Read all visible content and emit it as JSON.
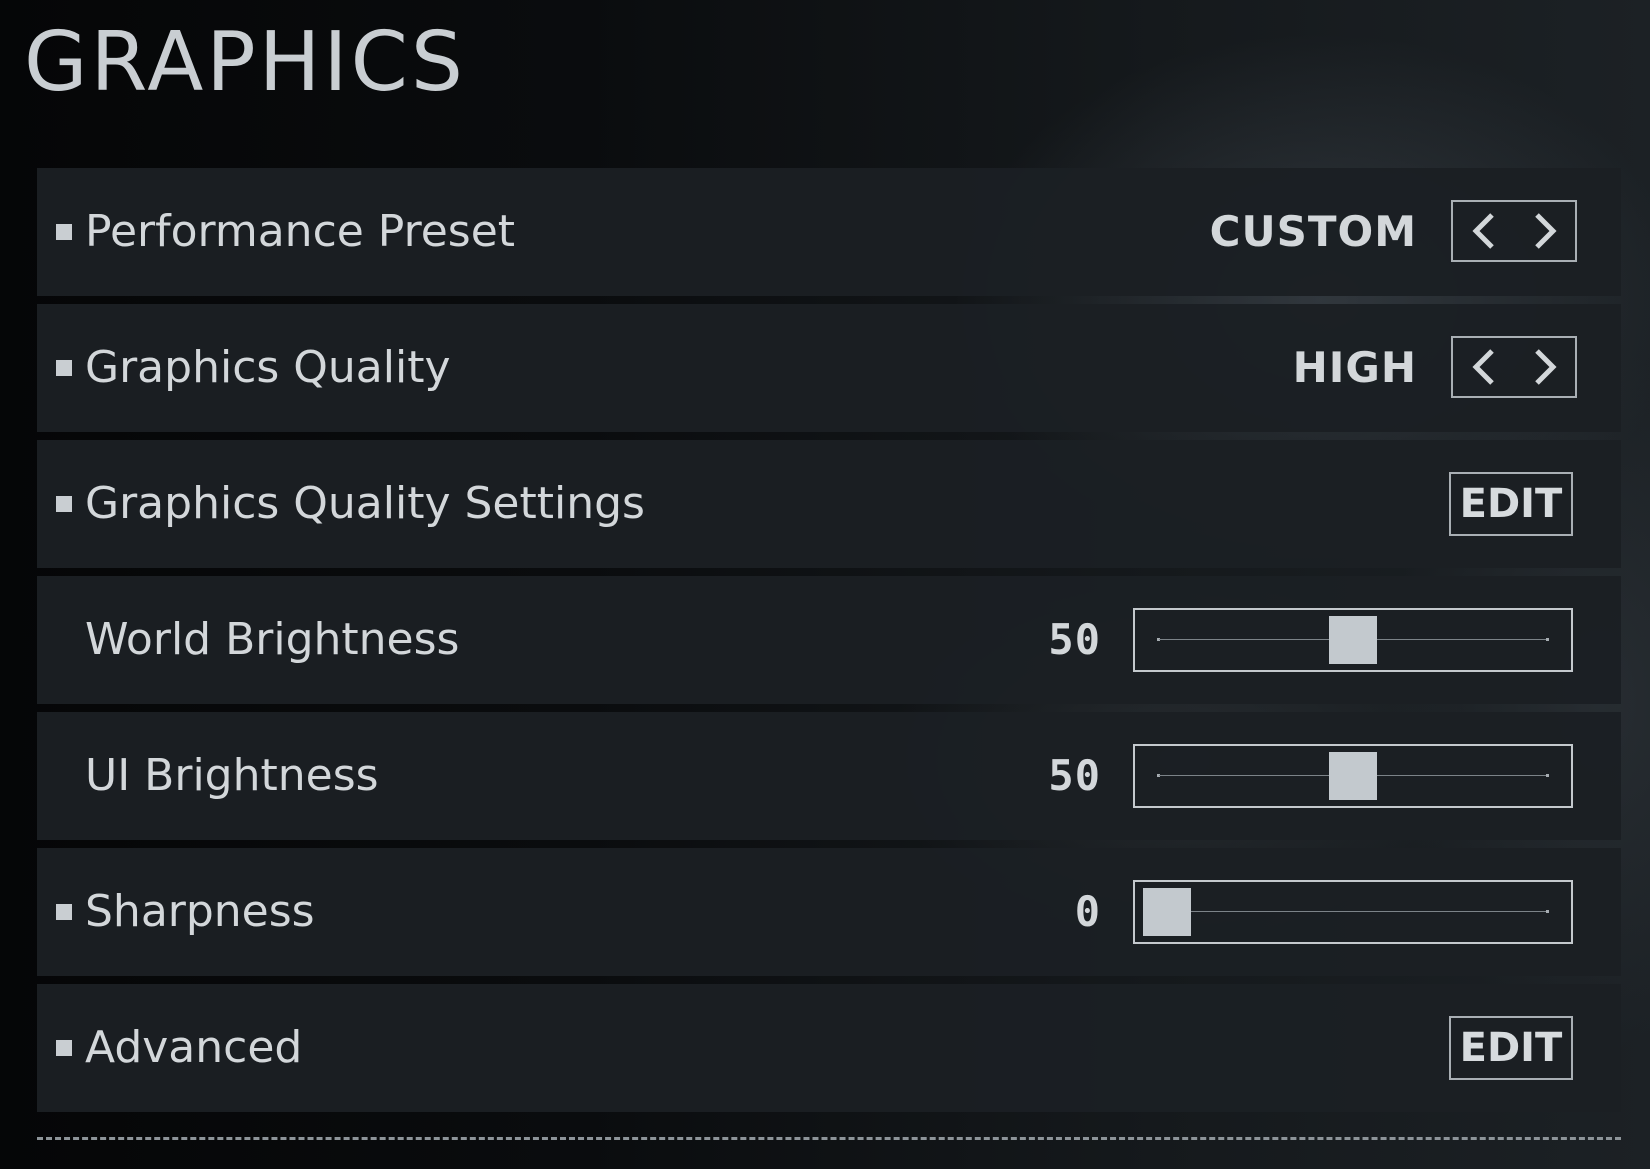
{
  "page": {
    "title": "GRAPHICS"
  },
  "settings": {
    "performance_preset": {
      "label": "Performance Preset",
      "value": "CUSTOM"
    },
    "graphics_quality": {
      "label": "Graphics Quality",
      "value": "HIGH"
    },
    "graphics_quality_settings": {
      "label": "Graphics Quality Settings",
      "button": "EDIT"
    },
    "world_brightness": {
      "label": "World Brightness",
      "value": "50",
      "level": 0.5
    },
    "ui_brightness": {
      "label": "UI Brightness",
      "value": "50",
      "level": 0.5
    },
    "sharpness": {
      "label": "Sharpness",
      "value": "0",
      "level": 0
    },
    "advanced": {
      "label": "Advanced",
      "button": "EDIT"
    }
  },
  "icons": {
    "bullet": "square-bullet-icon",
    "prev": "chevron-left-icon",
    "next": "chevron-right-icon"
  },
  "colors": {
    "text": "#d3d7da",
    "row_background": "#1b1f23",
    "slider_thumb": "#c3c9ce"
  }
}
